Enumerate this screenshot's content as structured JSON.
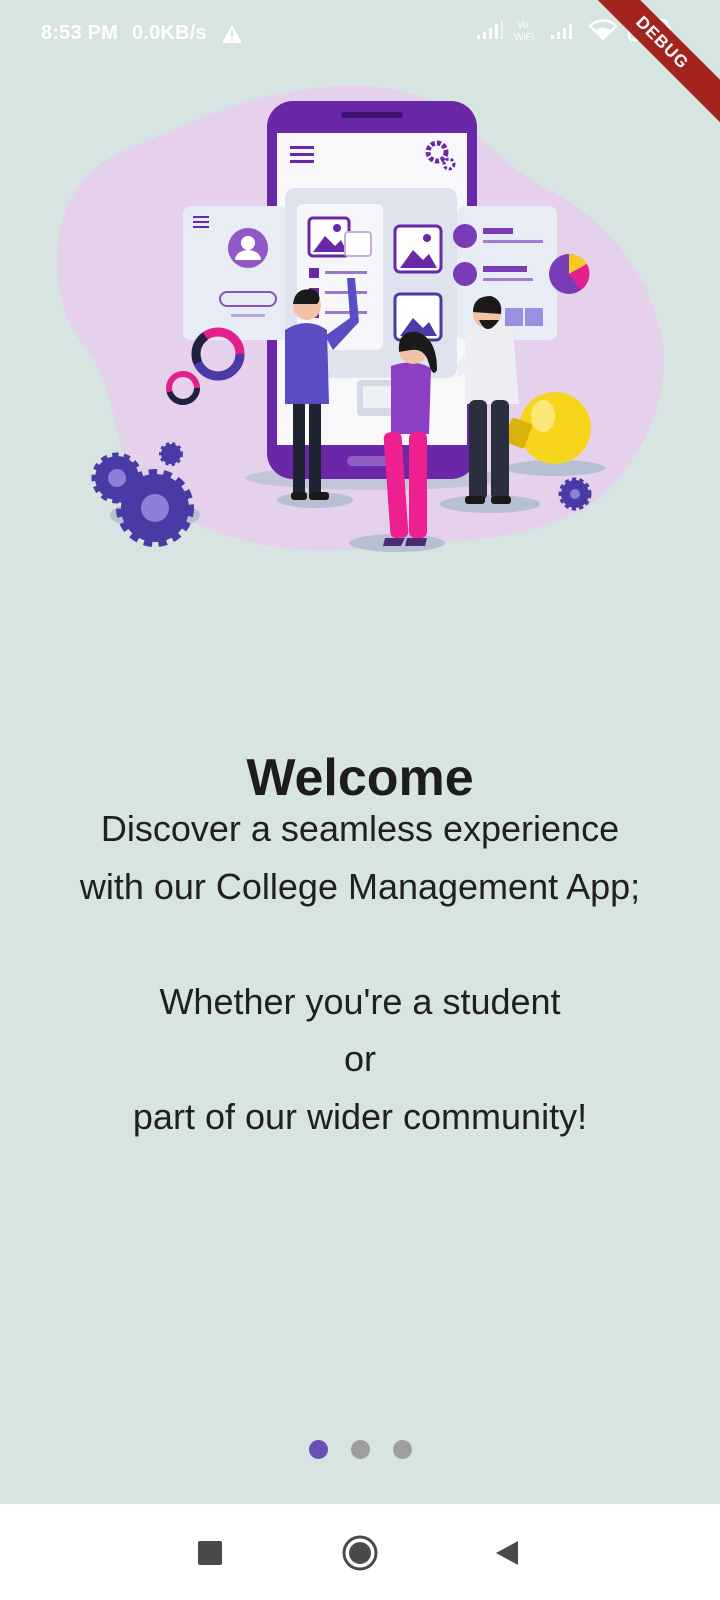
{
  "status": {
    "time": "8:53 PM",
    "net_speed": "0.0KB/s",
    "battery_level": "24",
    "debug_label": "DEBUG"
  },
  "welcome": {
    "title": "Welcome",
    "line1": "Discover a seamless experience",
    "line2": "with our College Management App;",
    "line3": "Whether you're a student",
    "line4": "or",
    "line5": "part of our wider community!"
  },
  "pager": {
    "total": 3,
    "active_index": 0
  },
  "colors": {
    "background": "#d6e5e2",
    "accent": "#6c4fb3",
    "inactive_dot": "#9e9e9e"
  },
  "nav": {
    "icons": [
      "recent-apps-icon",
      "home-icon",
      "back-icon"
    ]
  }
}
